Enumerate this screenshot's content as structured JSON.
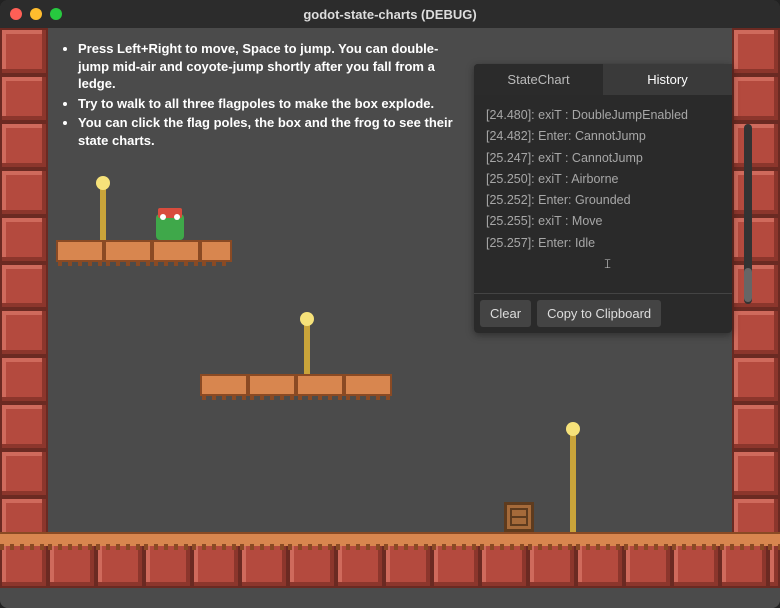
{
  "window": {
    "title": "godot-state-charts (DEBUG)"
  },
  "instructions": {
    "items": [
      "Press Left+Right to move, Space to jump. You can double-jump mid-air and coyote-jump shortly after you fall from a ledge.",
      "Try to walk to all three flagpoles to make the box explode.",
      "You can click the flag poles, the box and the frog to see their state charts."
    ]
  },
  "panel": {
    "tabs": {
      "statechart": "StateChart",
      "history": "History",
      "active": "history"
    },
    "log": [
      "[24.480]: exiT : DoubleJumpEnabled",
      "[24.482]: Enter: CannotJump",
      "[25.247]: exiT : CannotJump",
      "[25.250]: exiT : Airborne",
      "[25.252]: Enter: Grounded",
      "[25.255]: exiT : Move",
      "[25.257]: Enter: Idle"
    ],
    "buttons": {
      "clear": "Clear",
      "copy": "Copy to Clipboard"
    }
  }
}
